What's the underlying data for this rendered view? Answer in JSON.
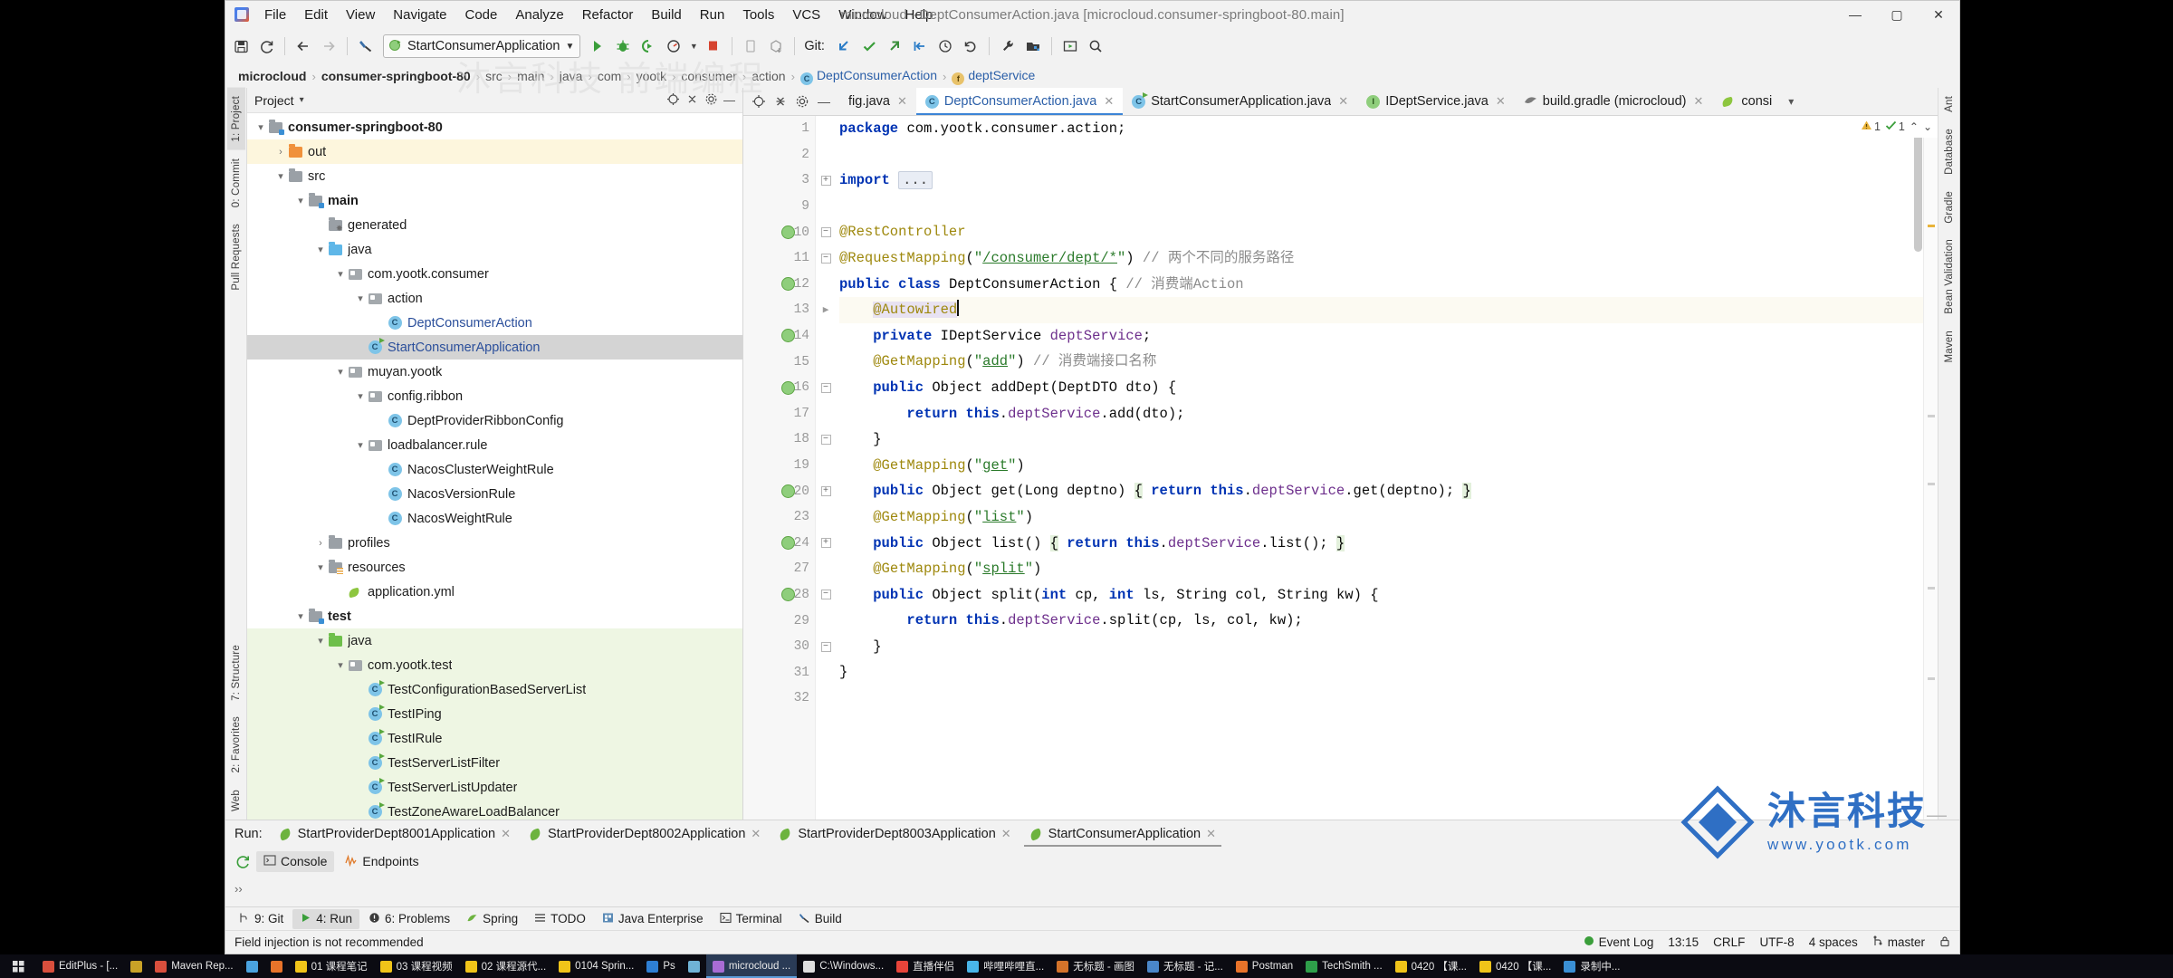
{
  "window": {
    "title": "microcloud - DeptConsumerAction.java [microcloud.consumer-springboot-80.main]",
    "minimize": "—",
    "maximize": "▢",
    "close": "✕"
  },
  "menubar": {
    "items": [
      "File",
      "Edit",
      "View",
      "Navigate",
      "Code",
      "Analyze",
      "Refactor",
      "Build",
      "Run",
      "Tools",
      "VCS",
      "Window",
      "Help"
    ]
  },
  "toolbar": {
    "run_config_name": "StartConsumerApplication",
    "git_label": "Git:",
    "icons": [
      "save-icon",
      "sync-icon",
      "back-arrow-icon",
      "forward-arrow-icon",
      "build-icon",
      "run-icon",
      "debug-icon",
      "run-with-coverage-icon",
      "profile-icon",
      "stop-icon",
      "device-manager-icon",
      "gradle-sync-icon",
      "update-project-icon",
      "commit-icon",
      "push-icon",
      "pull-icon",
      "history-icon",
      "rollback-icon",
      "settings-wrench-icon",
      "project-structure-icon",
      "preview-icon",
      "search-everywhere-icon"
    ]
  },
  "breadcrumbs": {
    "items": [
      {
        "label": "microcloud",
        "style": "bold"
      },
      {
        "label": "consumer-springboot-80",
        "style": "bold"
      },
      {
        "label": "src",
        "style": "dim"
      },
      {
        "label": "main",
        "style": "dim"
      },
      {
        "label": "java",
        "style": "dim"
      },
      {
        "label": "com",
        "style": "dim"
      },
      {
        "label": "yootk",
        "style": "dim"
      },
      {
        "label": "consumer",
        "style": "dim"
      },
      {
        "label": "action",
        "style": "dim"
      },
      {
        "label": "DeptConsumerAction",
        "style": "class",
        "badge": "C"
      },
      {
        "label": "deptService",
        "style": "field",
        "badge": "f"
      }
    ],
    "separator": "›"
  },
  "left_strip": {
    "tabs": [
      "1: Project",
      "0: Commit",
      "Pull Requests",
      "7: Structure",
      "2: Favorites",
      "Web"
    ]
  },
  "right_strip": {
    "tabs": [
      "Ant",
      "Database",
      "Gradle",
      "Bean Validation",
      "Maven"
    ]
  },
  "project_panel": {
    "title": "Project",
    "chevron": "▾",
    "tree": [
      {
        "label": "consumer-springboot-80",
        "indent": 0,
        "arrow": "▾",
        "icon": "module-folder-icon",
        "bold": true,
        "highlight": "none"
      },
      {
        "label": "out",
        "indent": 1,
        "arrow": "›",
        "icon": "excluded-folder-icon",
        "bold": false,
        "highlight": "yellow"
      },
      {
        "label": "src",
        "indent": 1,
        "arrow": "▾",
        "icon": "folder-icon",
        "bold": false,
        "highlight": "none"
      },
      {
        "label": "main",
        "indent": 2,
        "arrow": "▾",
        "icon": "module-folder-icon",
        "bold": true,
        "highlight": "none"
      },
      {
        "label": "generated",
        "indent": 3,
        "arrow": "",
        "icon": "generated-folder-icon",
        "bold": false,
        "highlight": "none"
      },
      {
        "label": "java",
        "indent": 3,
        "arrow": "▾",
        "icon": "source-folder-icon",
        "bold": false,
        "highlight": "none"
      },
      {
        "label": "com.yootk.consumer",
        "indent": 4,
        "arrow": "▾",
        "icon": "package-icon",
        "bold": false,
        "highlight": "none"
      },
      {
        "label": "action",
        "indent": 5,
        "arrow": "▾",
        "icon": "package-icon",
        "bold": false,
        "highlight": "none"
      },
      {
        "label": "DeptConsumerAction",
        "indent": 6,
        "arrow": "",
        "icon": "class-icon",
        "bold": false,
        "highlight": "none",
        "link": true
      },
      {
        "label": "StartConsumerApplication",
        "indent": 5,
        "arrow": "",
        "icon": "runnable-class-icon",
        "bold": false,
        "highlight": "selected",
        "link": true
      },
      {
        "label": "muyan.yootk",
        "indent": 4,
        "arrow": "▾",
        "icon": "package-icon",
        "bold": false,
        "highlight": "none"
      },
      {
        "label": "config.ribbon",
        "indent": 5,
        "arrow": "▾",
        "icon": "package-icon",
        "bold": false,
        "highlight": "none"
      },
      {
        "label": "DeptProviderRibbonConfig",
        "indent": 6,
        "arrow": "",
        "icon": "class-icon",
        "bold": false,
        "highlight": "none"
      },
      {
        "label": "loadbalancer.rule",
        "indent": 5,
        "arrow": "▾",
        "icon": "package-icon",
        "bold": false,
        "highlight": "none"
      },
      {
        "label": "NacosClusterWeightRule",
        "indent": 6,
        "arrow": "",
        "icon": "class-icon",
        "bold": false,
        "highlight": "none"
      },
      {
        "label": "NacosVersionRule",
        "indent": 6,
        "arrow": "",
        "icon": "class-icon",
        "bold": false,
        "highlight": "none"
      },
      {
        "label": "NacosWeightRule",
        "indent": 6,
        "arrow": "",
        "icon": "class-icon",
        "bold": false,
        "highlight": "none"
      },
      {
        "label": "profiles",
        "indent": 3,
        "arrow": "›",
        "icon": "folder-icon",
        "bold": false,
        "highlight": "none"
      },
      {
        "label": "resources",
        "indent": 3,
        "arrow": "▾",
        "icon": "resources-folder-icon",
        "bold": false,
        "highlight": "none"
      },
      {
        "label": "application.yml",
        "indent": 4,
        "arrow": "",
        "icon": "yaml-spring-icon",
        "bold": false,
        "highlight": "none"
      },
      {
        "label": "test",
        "indent": 2,
        "arrow": "▾",
        "icon": "test-module-folder-icon",
        "bold": true,
        "highlight": "none"
      },
      {
        "label": "java",
        "indent": 3,
        "arrow": "▾",
        "icon": "test-source-folder-icon",
        "bold": false,
        "highlight": "green"
      },
      {
        "label": "com.yootk.test",
        "indent": 4,
        "arrow": "▾",
        "icon": "package-icon",
        "bold": false,
        "highlight": "green"
      },
      {
        "label": "TestConfigurationBasedServerList",
        "indent": 5,
        "arrow": "",
        "icon": "runnable-class-icon",
        "bold": false,
        "highlight": "green"
      },
      {
        "label": "TestIPing",
        "indent": 5,
        "arrow": "",
        "icon": "runnable-class-icon",
        "bold": false,
        "highlight": "green"
      },
      {
        "label": "TestIRule",
        "indent": 5,
        "arrow": "",
        "icon": "runnable-class-icon",
        "bold": false,
        "highlight": "green"
      },
      {
        "label": "TestServerListFilter",
        "indent": 5,
        "arrow": "",
        "icon": "runnable-class-icon",
        "bold": false,
        "highlight": "green"
      },
      {
        "label": "TestServerListUpdater",
        "indent": 5,
        "arrow": "",
        "icon": "runnable-class-icon",
        "bold": false,
        "highlight": "green"
      },
      {
        "label": "TestZoneAwareLoadBalancer",
        "indent": 5,
        "arrow": "",
        "icon": "runnable-class-icon",
        "bold": false,
        "highlight": "green"
      }
    ]
  },
  "editor_tabs": {
    "tools": [
      "locate-icon",
      "collapse-all-icon",
      "settings-gear-icon",
      "hide-icon"
    ],
    "tabs": [
      {
        "label": "fig.java",
        "icon": "none",
        "active": false,
        "closable": true
      },
      {
        "label": "DeptConsumerAction.java",
        "icon": "class-icon",
        "active": true,
        "closable": true
      },
      {
        "label": "StartConsumerApplication.java",
        "icon": "runnable-class-icon",
        "active": false,
        "closable": true
      },
      {
        "label": "IDeptService.java",
        "icon": "interface-icon",
        "active": false,
        "closable": true
      },
      {
        "label": "build.gradle (microcloud)",
        "icon": "gradle-icon",
        "active": false,
        "closable": true
      },
      {
        "label": "consi",
        "icon": "yaml-spring-icon",
        "active": false,
        "closable": false
      }
    ],
    "overflow": "▾"
  },
  "inspection": {
    "warning_icon": "warning-triangle-icon",
    "warning_count": "1",
    "check_icon": "check-mark-icon",
    "check_count": "1",
    "up_arrow": "⌃",
    "down_arrow": "⌄"
  },
  "code": {
    "language": "Java",
    "lines": [
      {
        "num": "1",
        "marker": "",
        "fold": "",
        "text": "package com.yootk.consumer.action;"
      },
      {
        "num": "2",
        "marker": "",
        "fold": "",
        "text": ""
      },
      {
        "num": "3",
        "marker": "",
        "fold": "+",
        "text": "import ..."
      },
      {
        "num": "9",
        "marker": "",
        "fold": "",
        "text": ""
      },
      {
        "num": "10",
        "marker": "bean",
        "fold": "−",
        "text": "@RestController"
      },
      {
        "num": "11",
        "marker": "",
        "fold": "−",
        "text": "@RequestMapping(\"/consumer/dept/*\") // 两个不同的服务路径"
      },
      {
        "num": "12",
        "marker": "bean",
        "fold": "",
        "text": "public class DeptConsumerAction { // 消费端Action"
      },
      {
        "num": "13",
        "marker": "",
        "fold": "▸",
        "text": "    @Autowired"
      },
      {
        "num": "14",
        "marker": "bean",
        "fold": "",
        "text": "    private IDeptService deptService;"
      },
      {
        "num": "15",
        "marker": "",
        "fold": "",
        "text": "    @GetMapping(\"add\") // 消费端接口名称"
      },
      {
        "num": "16",
        "marker": "bean",
        "fold": "−",
        "text": "    public Object addDept(DeptDTO dto) {"
      },
      {
        "num": "17",
        "marker": "",
        "fold": "",
        "text": "        return this.deptService.add(dto);"
      },
      {
        "num": "18",
        "marker": "",
        "fold": "−",
        "text": "    }"
      },
      {
        "num": "19",
        "marker": "",
        "fold": "",
        "text": "    @GetMapping(\"get\")"
      },
      {
        "num": "20",
        "marker": "bean",
        "fold": "+",
        "text": "    public Object get(Long deptno) { return this.deptService.get(deptno); }"
      },
      {
        "num": "23",
        "marker": "",
        "fold": "",
        "text": "    @GetMapping(\"list\")"
      },
      {
        "num": "24",
        "marker": "bean",
        "fold": "+",
        "text": "    public Object list() { return this.deptService.list(); }"
      },
      {
        "num": "27",
        "marker": "",
        "fold": "",
        "text": "    @GetMapping(\"split\")"
      },
      {
        "num": "28",
        "marker": "bean",
        "fold": "−",
        "text": "    public Object split(int cp, int ls, String col, String kw) {"
      },
      {
        "num": "29",
        "marker": "",
        "fold": "",
        "text": "        return this.deptService.split(cp, ls, col, kw);"
      },
      {
        "num": "30",
        "marker": "",
        "fold": "−",
        "text": "    }"
      },
      {
        "num": "31",
        "marker": "",
        "fold": "",
        "text": "}"
      },
      {
        "num": "32",
        "marker": "",
        "fold": "",
        "text": ""
      }
    ]
  },
  "run_panel": {
    "label": "Run:",
    "tabs": [
      {
        "label": "StartProviderDept8001Application",
        "active": false
      },
      {
        "label": "StartProviderDept8002Application",
        "active": false
      },
      {
        "label": "StartProviderDept8003Application",
        "active": false
      },
      {
        "label": "StartConsumerApplication",
        "active": true
      }
    ],
    "subtabs": [
      {
        "label": "Console",
        "icon": "console-icon",
        "active": true
      },
      {
        "label": "Endpoints",
        "icon": "endpoints-icon",
        "active": false
      }
    ],
    "rerun_icon": "rerun-icon",
    "footer": "››"
  },
  "tool_windows": {
    "items": [
      {
        "label": "9: Git",
        "icon": "git-branch-icon",
        "active": false
      },
      {
        "label": "4: Run",
        "icon": "run-triangle-icon",
        "active": true
      },
      {
        "label": "6: Problems",
        "icon": "problems-icon",
        "active": false
      },
      {
        "label": "Spring",
        "icon": "spring-leaf-icon",
        "active": false
      },
      {
        "label": "TODO",
        "icon": "todo-list-icon",
        "active": false
      },
      {
        "label": "Java Enterprise",
        "icon": "java-enterprise-icon",
        "active": false
      },
      {
        "label": "Terminal",
        "icon": "terminal-icon",
        "active": false
      },
      {
        "label": "Build",
        "icon": "build-hammer-icon",
        "active": false
      }
    ]
  },
  "status_bar": {
    "message": "Field injection is not recommended",
    "event_log": "Event Log",
    "position": "13:15",
    "line_separator": "CRLF",
    "encoding": "UTF-8",
    "indent": "4 spaces",
    "branch": "master",
    "branch_icon": "git-branch-icon",
    "lock_icon": "lock-icon"
  },
  "watermark": {
    "title": "沐言科技",
    "subtitle": "www.yootk.com",
    "faint": "沐言科技 前端编程"
  },
  "taskbar": {
    "start_icon": "start-menu-icon",
    "items": [
      {
        "label": "EditPlus - [...",
        "color": "#d94f3d",
        "active": false
      },
      {
        "label": "",
        "color": "#c9a227",
        "active": false
      },
      {
        "label": "Maven Rep...",
        "color": "#d94f3d",
        "active": false
      },
      {
        "label": "",
        "color": "#4aa3df",
        "active": false
      },
      {
        "label": "",
        "color": "#e8732a",
        "active": false
      },
      {
        "label": "01 课程笔记",
        "color": "#f0c419",
        "active": false
      },
      {
        "label": "03 课程视频",
        "color": "#f0c419",
        "active": false
      },
      {
        "label": "02 课程源代...",
        "color": "#f0c419",
        "active": false
      },
      {
        "label": "0104 Sprin...",
        "color": "#f0c419",
        "active": false
      },
      {
        "label": "Ps",
        "color": "#2e7fd4",
        "active": false
      },
      {
        "label": "",
        "color": "#6fb3d6",
        "active": false
      },
      {
        "label": "microcloud ...",
        "color": "#a86cd4",
        "active": true
      },
      {
        "label": "C:\\Windows...",
        "color": "#dedede",
        "active": false
      },
      {
        "label": "直播伴侣",
        "color": "#e8443a",
        "active": false
      },
      {
        "label": "哔哩哔哩直...",
        "color": "#49b5e8",
        "active": false
      },
      {
        "label": "无标题 - 画图",
        "color": "#d4732a",
        "active": false
      },
      {
        "label": "无标题 - 记...",
        "color": "#4a86c8",
        "active": false
      },
      {
        "label": "Postman",
        "color": "#e8732a",
        "active": false
      },
      {
        "label": "TechSmith ...",
        "color": "#2e9e4a",
        "active": false
      },
      {
        "label": "0420 【课...",
        "color": "#f0c419",
        "active": false
      },
      {
        "label": "0420 【课...",
        "color": "#f0c419",
        "active": false
      },
      {
        "label": "录制中...",
        "color": "#3a8fd4",
        "active": false
      }
    ]
  }
}
